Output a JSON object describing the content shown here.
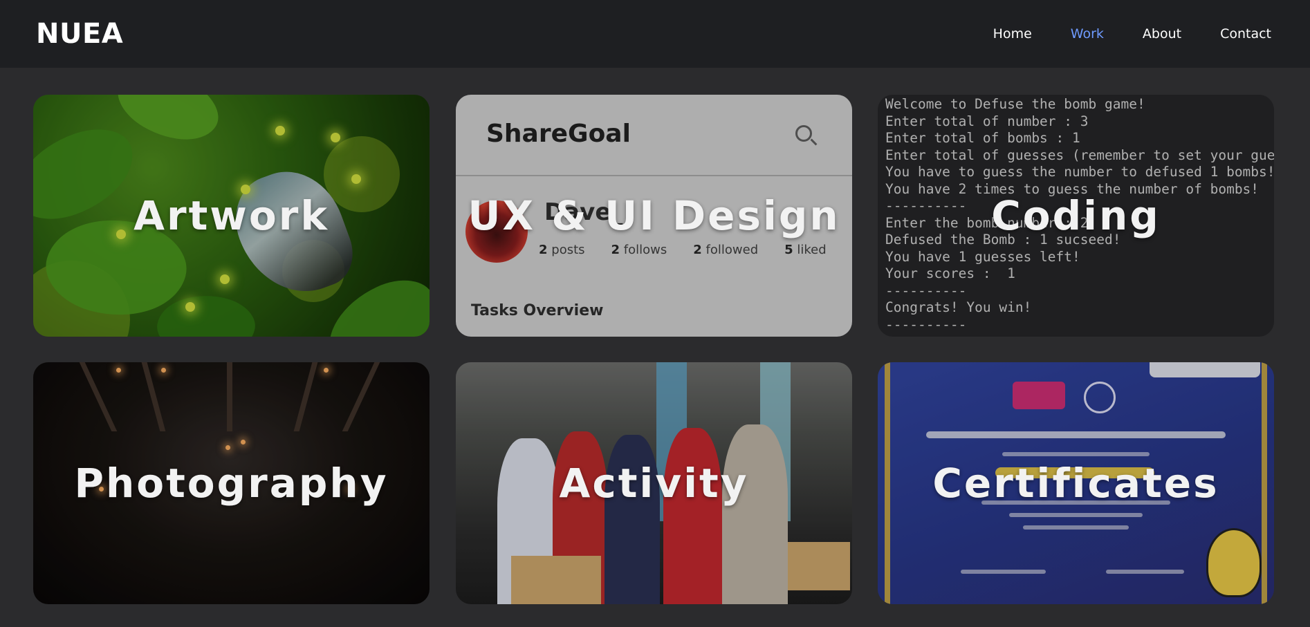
{
  "header": {
    "logo": "NUEA",
    "nav": [
      {
        "label": "Home",
        "active": false
      },
      {
        "label": "Work",
        "active": true
      },
      {
        "label": "About",
        "active": false
      },
      {
        "label": "Contact",
        "active": false
      }
    ],
    "active_color": "#6f9bff"
  },
  "cards": [
    {
      "title": "Artwork"
    },
    {
      "title": "UX & UI Design",
      "mock": {
        "brand": "ShareGoal",
        "user": "Dave_",
        "stats": [
          {
            "num": "2",
            "label": "posts"
          },
          {
            "num": "2",
            "label": "follows"
          },
          {
            "num": "2",
            "label": "followed"
          },
          {
            "num": "5",
            "label": "liked"
          }
        ],
        "section": "Tasks Overview"
      }
    },
    {
      "title": "Coding",
      "console": [
        "Welcome to Defuse the bomb game!",
        "Enter total of number : 3",
        "Enter total of bombs : 1",
        "Enter total of guesses (remember to set your guess n",
        "You have to guess the number to defused 1 bombs!",
        "You have 2 times to guess the number of bombs!",
        "----------",
        "Enter the bomb number : 2",
        "Defused the Bomb : 1 sucseed!",
        "You have 1 guesses left!",
        "Your scores :  1",
        "----------",
        "Congrats! You win!",
        "----------"
      ]
    },
    {
      "title": "Photography"
    },
    {
      "title": "Activity"
    },
    {
      "title": "Certificates"
    }
  ]
}
